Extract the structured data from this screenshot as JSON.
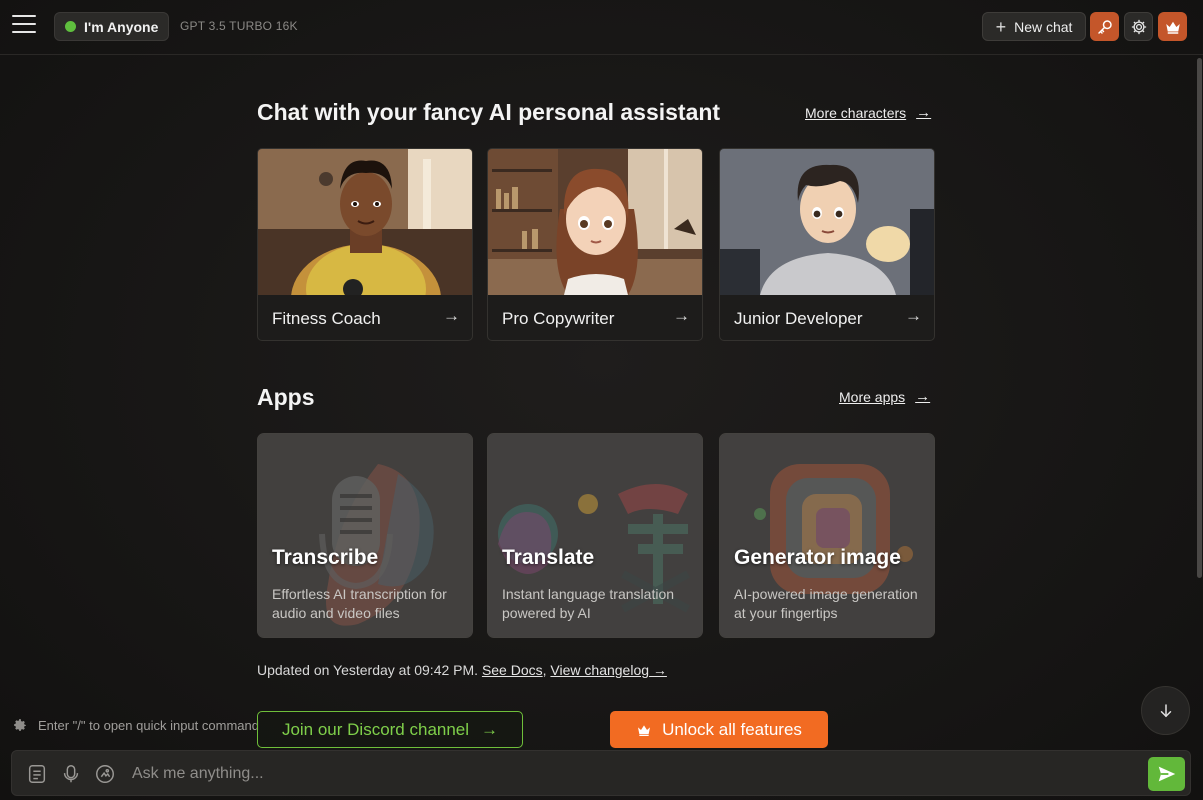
{
  "header": {
    "persona_name": "I'm Anyone",
    "model": "GPT 3.5 TURBO 16K",
    "new_chat_label": "New chat",
    "status_color": "#5fbf3e",
    "accent_color": "#c4562a"
  },
  "characters_section": {
    "title": "Chat with your fancy AI personal assistant",
    "more_label": "More characters",
    "items": [
      {
        "label": "Fitness Coach"
      },
      {
        "label": "Pro Copywriter"
      },
      {
        "label": "Junior Developer"
      }
    ]
  },
  "apps_section": {
    "title": "Apps",
    "more_label": "More apps",
    "items": [
      {
        "title": "Transcribe",
        "desc": "Effortless AI transcription for audio and video files"
      },
      {
        "title": "Translate",
        "desc": "Instant language translation powered by AI"
      },
      {
        "title": "Generator image",
        "desc": "AI-powered image generation at your fingertips"
      }
    ]
  },
  "footer": {
    "updated_prefix": "Updated on Yesterday at 09:42 PM.",
    "see_docs": "See Docs",
    "separator": ",",
    "changelog": "View changelog →",
    "hint": "Enter \"/\" to open quick input command",
    "discord_label": "Join our Discord channel",
    "unlock_label": "Unlock all features",
    "unlock_color": "#f26b22",
    "discord_color": "#6fbf3a"
  },
  "composer": {
    "placeholder": "Ask me anything..."
  }
}
